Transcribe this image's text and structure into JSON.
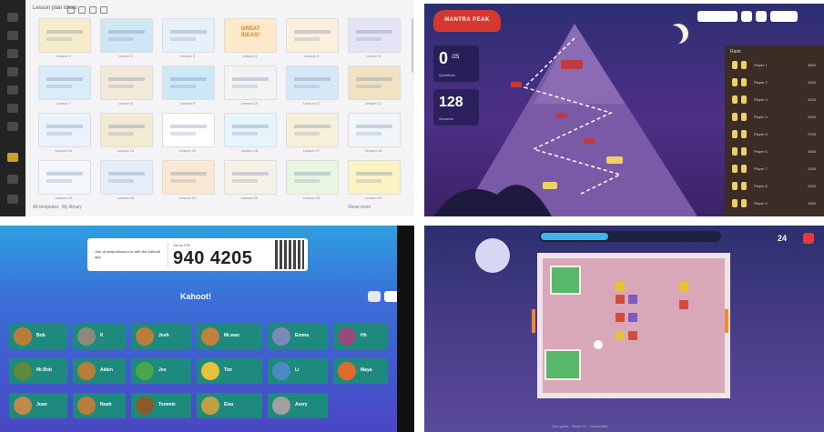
{
  "q1": {
    "header_title": "Lesson plan ideas",
    "footer_left": [
      "All templates",
      "My library"
    ],
    "footer_right": "Show more",
    "thumb_colors": [
      [
        "#f6ecc9",
        "#cfe6f5",
        "#e6f0f8",
        "#fbe9c9",
        "#fcefdc",
        "#e4e4f6"
      ],
      [
        "#d8ecf9",
        "#f2e9d8",
        "#cde8f6",
        "#f3f3f3",
        "#d6e8f8",
        "#f1e2c2"
      ],
      [
        "#eaf2fb",
        "#f3ead3",
        "#ffffff",
        "#e6f4fb",
        "#f7f0d9",
        "#f1f6fb"
      ],
      [
        "#f3f7fb",
        "#e5eef8",
        "#fbe8d3",
        "#f5f1e6",
        "#e8f5e0",
        "#fbf3c2"
      ]
    ],
    "captions": [
      [
        "Lesson 1",
        "Lesson 2",
        "Lesson 3",
        "Lesson 4",
        "Lesson 5",
        "Lesson 6"
      ],
      [
        "Lesson 7",
        "Lesson 8",
        "Lesson 9",
        "Lesson 10",
        "Lesson 11",
        "Lesson 12"
      ],
      [
        "Lesson 13",
        "Lesson 14",
        "Lesson 15",
        "Lesson 16",
        "Lesson 17",
        "Lesson 18"
      ],
      [
        "Lesson 19",
        "Lesson 20",
        "Lesson 21",
        "Lesson 22",
        "Lesson 23",
        "Lesson 24"
      ]
    ],
    "special_thumb_text": "GREAT\nIDEAS!"
  },
  "q2": {
    "logo_text": "MANTRA PEAK",
    "card1_big": "0",
    "card1_sup": "/25",
    "card1_small": "Questions",
    "card2_big": "128",
    "card2_small": "Seconds",
    "board_title": "Rank",
    "players": [
      {
        "name": "Player 1",
        "score": "3600"
      },
      {
        "name": "Player 2",
        "score": "3400"
      },
      {
        "name": "Player 3",
        "score": "3100"
      },
      {
        "name": "Player 4",
        "score": "2900"
      },
      {
        "name": "Player 5",
        "score": "2700"
      },
      {
        "name": "Player 6",
        "score": "2500"
      },
      {
        "name": "Player 7",
        "score": "2300"
      },
      {
        "name": "Player 8",
        "score": "2100"
      },
      {
        "name": "Player 9",
        "score": "1900"
      }
    ]
  },
  "q3": {
    "join_text": "Join at www.kahoot.it or with the Kahoot! app",
    "pin_label": "Game PIN:",
    "pin": "940 4205",
    "brand": "Kahoot!",
    "players": [
      {
        "name": "Bob",
        "color": "#b97d3a"
      },
      {
        "name": "K",
        "color": "#8e8a7a"
      },
      {
        "name": "Josh",
        "color": "#b97d3a"
      },
      {
        "name": "Mr.wan",
        "color": "#c08040"
      },
      {
        "name": "Emma",
        "color": "#7c8ab8"
      },
      {
        "name": "Hh",
        "color": "#9a4a7a"
      },
      {
        "name": "Mr.Bob",
        "color": "#5f8a3a"
      },
      {
        "name": "Aiden",
        "color": "#b97d3a"
      },
      {
        "name": "Joe",
        "color": "#4aa64a"
      },
      {
        "name": "Tim",
        "color": "#e6c23a"
      },
      {
        "name": "Li",
        "color": "#4a8ac0"
      },
      {
        "name": "Maya",
        "color": "#e06a2a"
      },
      {
        "name": "Juan",
        "color": "#c08a4a"
      },
      {
        "name": "Noah",
        "color": "#b97d3a"
      },
      {
        "name": "Tommie",
        "color": "#8a5a2a"
      },
      {
        "name": "Elsa",
        "color": "#c0a040"
      },
      {
        "name": "Avery",
        "color": "#a0a0a0"
      }
    ]
  },
  "q4": {
    "timer": "24",
    "progress": 0.38,
    "status": "Live game · Room 10 · Connected"
  }
}
